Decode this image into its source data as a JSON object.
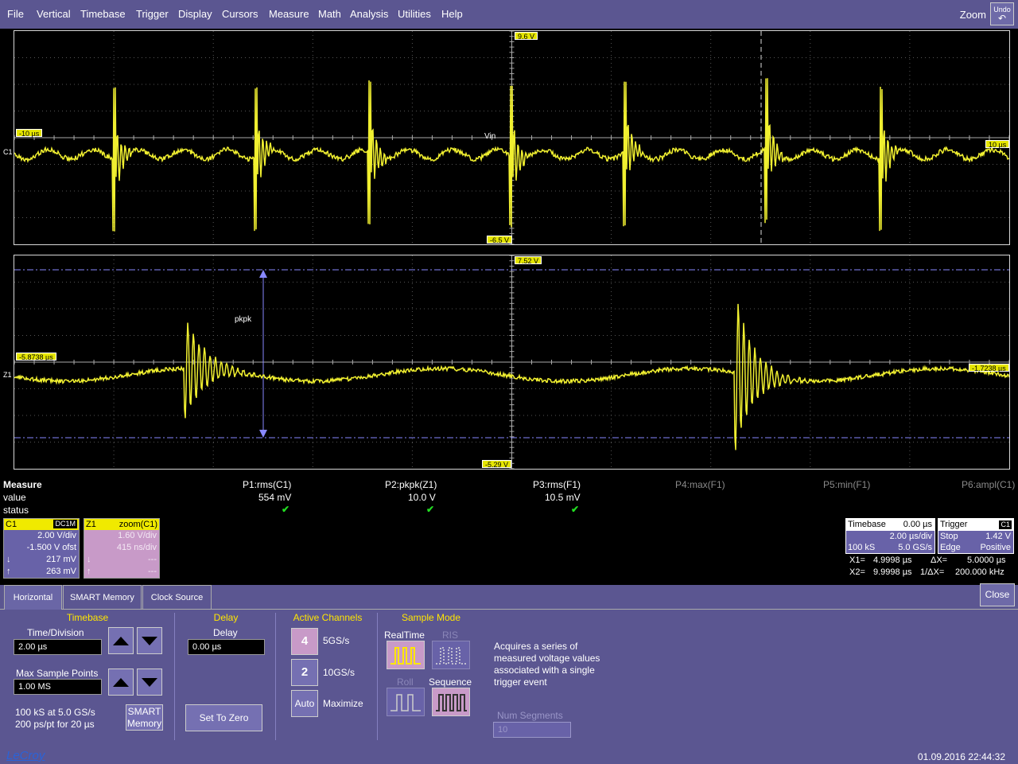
{
  "menu": {
    "items": [
      "File",
      "Vertical",
      "Timebase",
      "Trigger",
      "Display",
      "Cursors",
      "Measure",
      "Math",
      "Analysis",
      "Utilities",
      "Help"
    ],
    "zoom": "Zoom",
    "undo": "Undo"
  },
  "grid1": {
    "top_level": "9.6 V",
    "bottom_level": "-6.5 V",
    "left_time": "-10 µs",
    "right_time": "10 µs",
    "trace_label": "Vin",
    "channel_marker": "C1",
    "trace_color": "#f0ef30"
  },
  "grid2": {
    "top_level": "7.52 V",
    "bottom_level": "-5.29 V",
    "left_time": "-5.8738 µs",
    "right_time": "-1.7238 µs",
    "marker_label": "pkpk",
    "channel_marker": "Z1"
  },
  "measure": {
    "title": "Measure",
    "row_value": "value",
    "row_status": "status",
    "params": [
      {
        "name": "P1:rms(C1)",
        "value": "554 mV",
        "status": "✔"
      },
      {
        "name": "P2:pkpk(Z1)",
        "value": "10.0 V",
        "status": "✔"
      },
      {
        "name": "P3:rms(F1)",
        "value": "10.5 mV",
        "status": "✔"
      },
      {
        "name": "P4:max(F1)",
        "value": "",
        "status": ""
      },
      {
        "name": "P5:min(F1)",
        "value": "",
        "status": ""
      },
      {
        "name": "P6:ampl(C1)",
        "value": "",
        "status": ""
      }
    ]
  },
  "c1": {
    "name": "C1",
    "coupling": "DC1M",
    "vdiv": "2.00 V/div",
    "offset": "-1.500 V ofst",
    "down": "217 mV",
    "up": "263 mV"
  },
  "z1": {
    "name": "Z1",
    "source": "zoom(C1)",
    "vdiv": "1.60 V/div",
    "tdiv": "415 ns/div",
    "down": "---",
    "up": "---"
  },
  "timebase": {
    "title": "Timebase",
    "delay": "0.00 µs",
    "tdiv": "2.00 µs/div",
    "samples": "100 kS",
    "rate": "5.0 GS/s"
  },
  "trigger": {
    "title": "Trigger",
    "channel": "C1",
    "mode": "Stop",
    "level": "1.42 V",
    "type": "Edge",
    "slope": "Positive"
  },
  "cursors": {
    "x1_label": "X1=",
    "x1": "4.9998 µs",
    "dx_label": "ΔX=",
    "dx": "5.0000 µs",
    "x2_label": "X2=",
    "x2": "9.9998 µs",
    "freq_label": "1/ΔX=",
    "freq": "200.000 kHz"
  },
  "tabs": [
    "Horizontal",
    "SMART Memory",
    "Clock Source"
  ],
  "close": "Close",
  "horizontal": {
    "timebase_title": "Timebase",
    "time_div_label": "Time/Division",
    "time_div_value": "2.00 µs",
    "max_points_label": "Max Sample Points",
    "max_points_value": "1.00 MS",
    "info1": "100 kS at 5.0 GS/s",
    "info2": "200 ps/pt for 20 µs",
    "smart_btn_1": "SMART",
    "smart_btn_2": "Memory"
  },
  "delay": {
    "title": "Delay",
    "label": "Delay",
    "value": "0.00 µs",
    "set_zero": "Set To Zero"
  },
  "channels": {
    "title": "Active Channels",
    "opt4": "4",
    "opt4_label": "5GS/s",
    "opt2": "2",
    "opt2_label": "10GS/s",
    "auto": "Auto",
    "auto_label": "Maximize"
  },
  "sample_mode": {
    "title": "Sample Mode",
    "realtime": "RealTime",
    "ris": "RIS",
    "roll": "Roll",
    "sequence": "Sequence",
    "desc1": "Acquires a series of",
    "desc2": "measured voltage values",
    "desc3": "associated with a single",
    "desc4": "trigger event",
    "num_segments_label": "Num Segments",
    "num_segments_value": "10"
  },
  "status": {
    "brand": "LeCroy",
    "datetime": "01.09.2016 22:44:32"
  }
}
